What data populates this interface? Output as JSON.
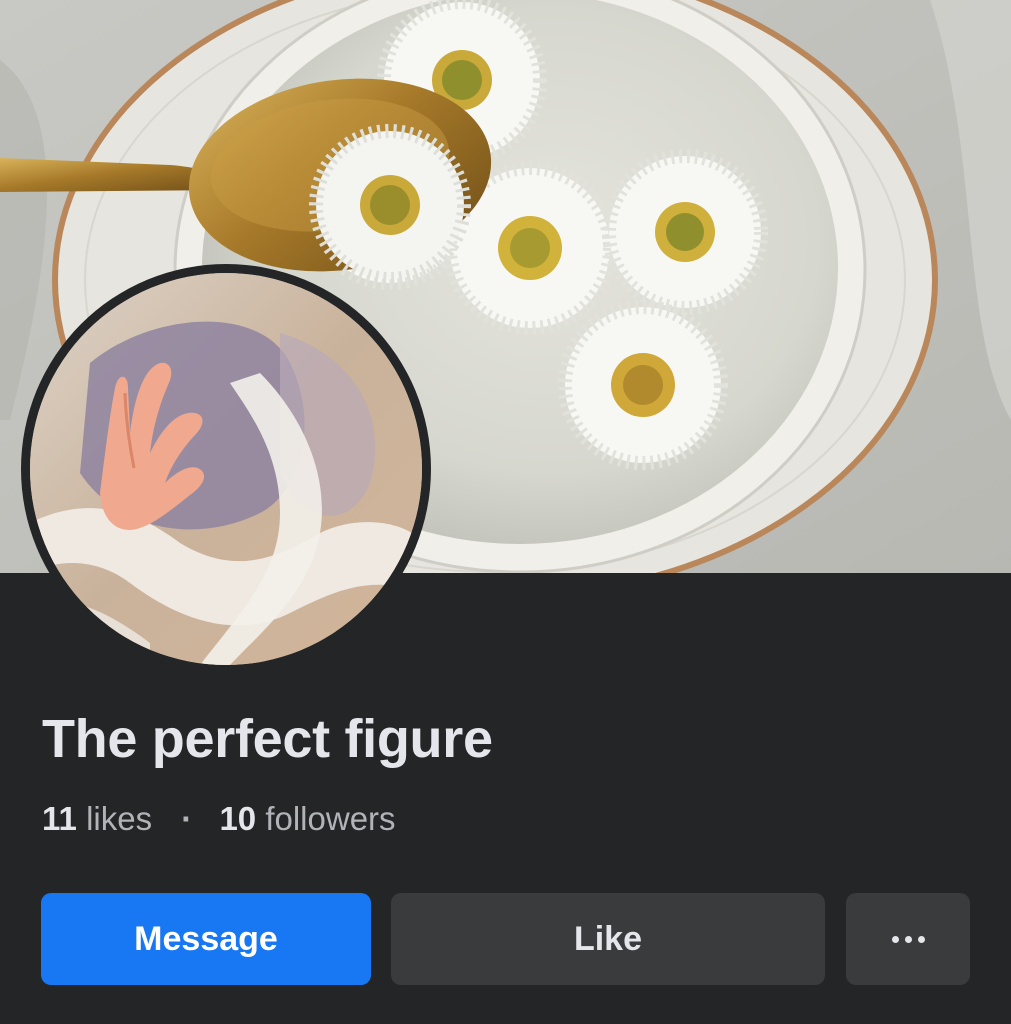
{
  "page": {
    "title": "The perfect figure",
    "likes_count": "11",
    "likes_label": "likes",
    "separator": "·",
    "followers_count": "10",
    "followers_label": "followers"
  },
  "cover_photo": {
    "icon": "cover-photo-daisies-in-bowl"
  },
  "profile_picture": {
    "icon": "profile-photo-hand-and-fabric"
  },
  "actions": {
    "message_label": "Message",
    "like_label": "Like",
    "more_icon": "more-options-icon"
  },
  "colors": {
    "background": "#242526",
    "primary_button": "#1877f2",
    "secondary_button": "#3a3b3c",
    "title_text": "#e4e6eb",
    "secondary_text": "#b0b3b8"
  }
}
